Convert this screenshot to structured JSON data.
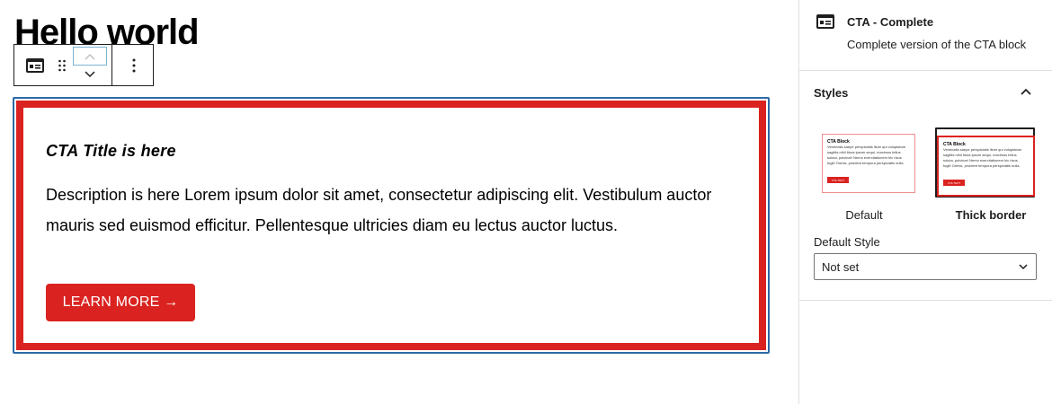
{
  "editor": {
    "post_title": "Hello world",
    "toolbar": {
      "block_type_icon": "cta-block-icon",
      "drag_icon": "drag-handle-icon",
      "move_up_icon": "chevron-up-icon",
      "move_down_icon": "chevron-down-icon",
      "more_icon": "more-vertical-icon"
    },
    "cta": {
      "title": "CTA Title is here",
      "description": "Description is here Lorem ipsum dolor sit amet, consectetur adipiscing elit. Vestibulum auctor mauris sed euismod efficitur. Pellentesque ultricies diam eu lectus auctor luctus.",
      "button_label": "LEARN MORE →",
      "border_color": "#da2320",
      "button_color": "#da2320",
      "selection_color": "#2c6aa6"
    }
  },
  "sidebar": {
    "block_card": {
      "icon": "cta-block-icon",
      "title": "CTA - Complete",
      "description": "Complete version of the CTA block"
    },
    "styles_panel": {
      "title": "Styles",
      "toggle_icon": "chevron-up-icon",
      "options": [
        {
          "label": "Default",
          "selected": false,
          "preview": {
            "title": "CTA Block",
            "text": "Venenatis saepe perspiciatis illum qui voluptatum sagittis nihil litora ipsum sequi, maximus tellus soluta, pulvinar! Nemo exercitationem hic risus fugit! Omnis, proident tempora perspiciatis nulla.",
            "button": "CTA TEXT"
          }
        },
        {
          "label": "Thick border",
          "selected": true,
          "preview": {
            "title": "CTA Block",
            "text": "Venenatis saepe perspiciatis illum qui voluptatum sagittis nihil litora ipsum sequi, maximus tellus soluta, pulvinar! Nemo exercitationem hic risus fugit! Omnis, proident tempora perspiciatis nulla.",
            "button": "CTA TEXT"
          }
        }
      ],
      "default_style_label": "Default Style",
      "default_style_value": "Not set"
    }
  }
}
